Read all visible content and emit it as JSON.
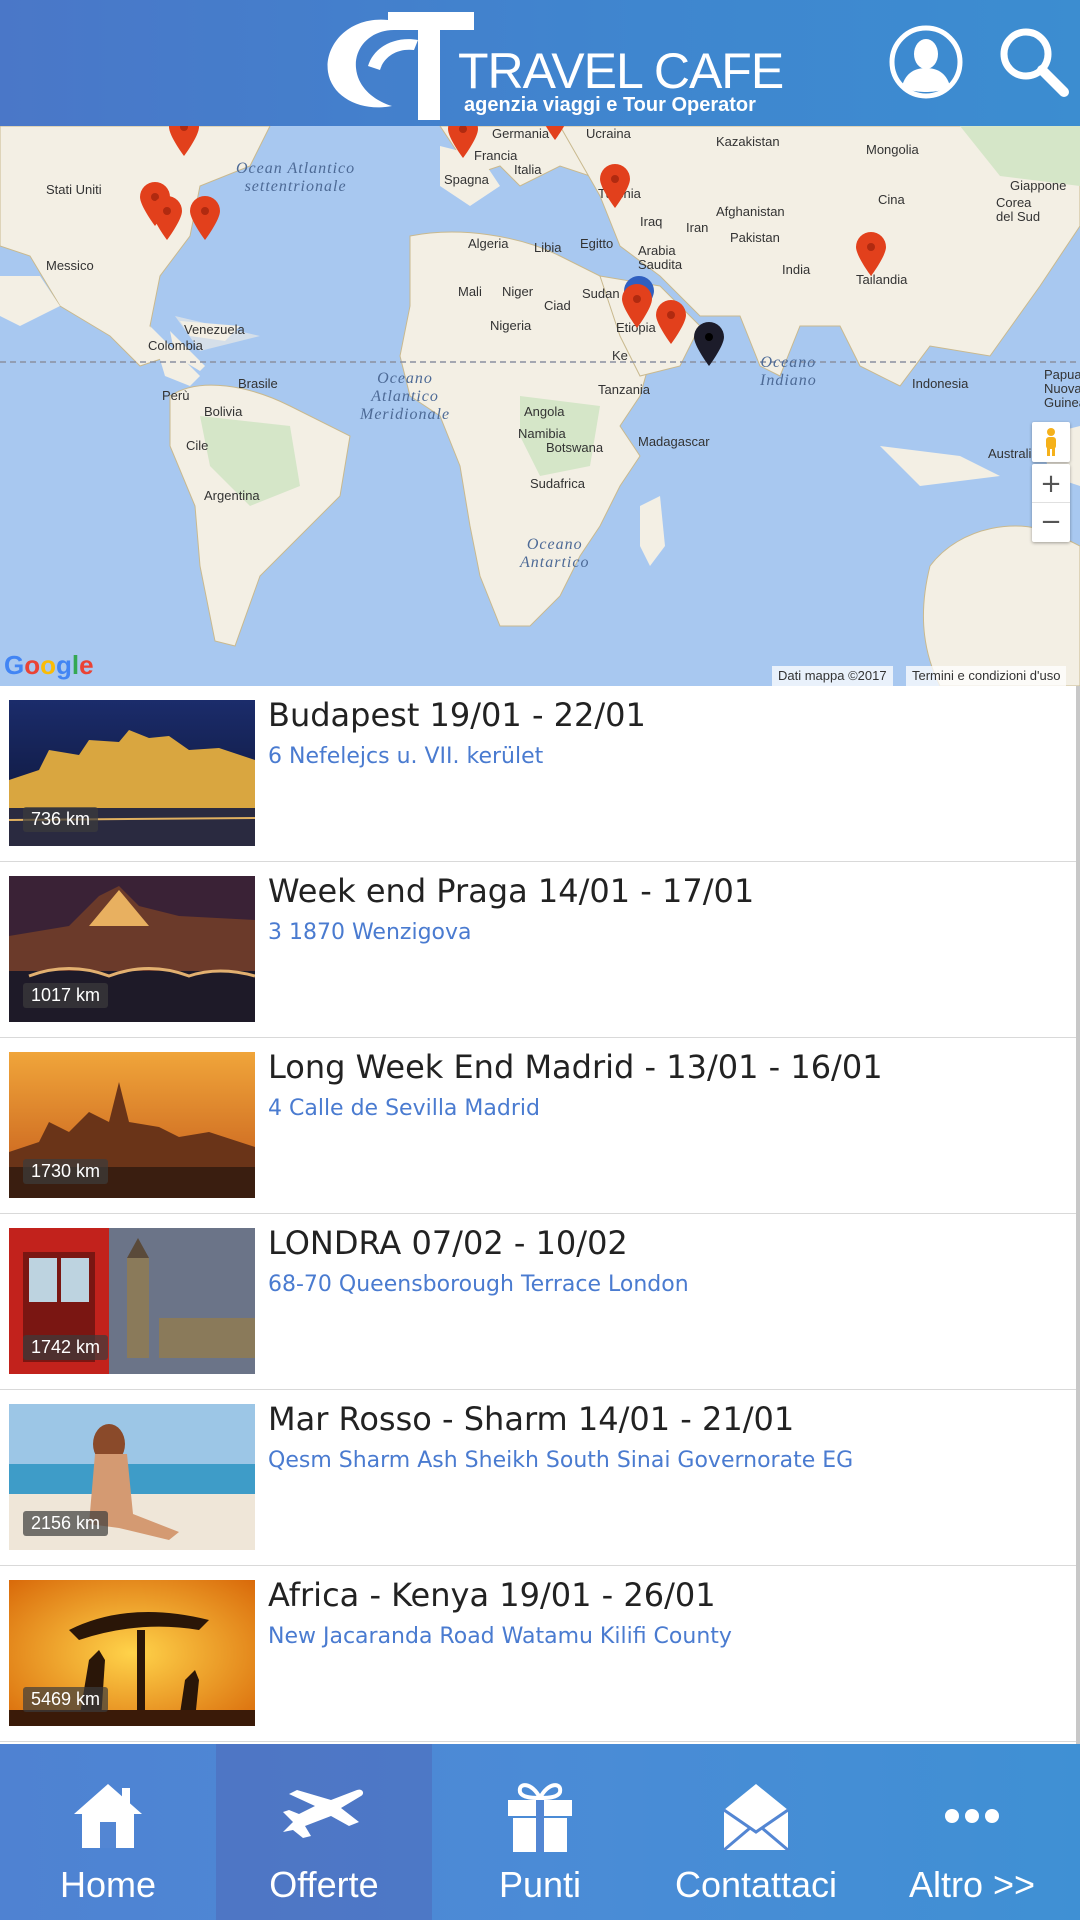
{
  "header": {
    "logo_text": "TRAVEL CAFE",
    "logo_subtitle": "agenzia viaggi e Tour Operator",
    "logo_mark": "CT"
  },
  "map": {
    "countries": {
      "stati_uniti": "Stati Uniti",
      "messico": "Messico",
      "venezuela": "Venezuela",
      "colombia": "Colombia",
      "peru": "Perù",
      "brasile": "Brasile",
      "bolivia": "Bolivia",
      "cile": "Cile",
      "argentina": "Argentina",
      "germania": "Germania",
      "ucraina": "Ucraina",
      "kazakistan": "Kazakistan",
      "mongolia": "Mongolia",
      "francia": "Francia",
      "italia": "Italia",
      "spagna": "Spagna",
      "turchia": "Turchia",
      "iraq": "Iraq",
      "iran": "Iran",
      "afghanistan": "Afghanistan",
      "pakistan": "Pakistan",
      "cina": "Cina",
      "giappone": "Giappone",
      "corea": "Corea\ndel Sud",
      "algeria": "Algeria",
      "libia": "Libia",
      "egitto": "Egitto",
      "arabia": "Arabia\nSaudita",
      "india": "India",
      "tailandia": "Tailandia",
      "mali": "Mali",
      "niger": "Niger",
      "ciad": "Ciad",
      "sudan": "Sudan",
      "nigeria": "Nigeria",
      "etiopia": "Etiopia",
      "kenya": "Ke",
      "tanzania": "Tanzania",
      "angola": "Angola",
      "namibia": "Namibia",
      "botswana": "Botswana",
      "madagascar": "Madagascar",
      "sudafrica": "Sudafrica",
      "indonesia": "Indonesia",
      "papua": "Papua\nNuova\nGuinea",
      "australia": "Australia"
    },
    "oceans": {
      "atl_n": "Ocean Atlantico\nsettentrionale",
      "atl_s": "Oceano\nAtlantico\nMeridionale",
      "indiano": "Oceano\nIndiano",
      "antartico": "Oceano\nAntartico"
    },
    "google": "Google",
    "attribution_data": "Dati mappa ©2017",
    "attribution_terms": "Termini e condizioni d'uso",
    "zoom_in": "+",
    "zoom_out": "−",
    "colors": {
      "water": "#a8c8f0",
      "land": "#f3efe4",
      "marker": "#e2401c",
      "marker_user": "#1c1c2a"
    }
  },
  "offers": [
    {
      "title": "Budapest 19/01 - 22/01",
      "address": "6 Nefelejcs u. VII. kerület",
      "distance": "736 km"
    },
    {
      "title": "Week end Praga 14/01 - 17/01",
      "address": "3 1870 Wenzigova",
      "distance": "1017 km"
    },
    {
      "title": "Long Week End Madrid - 13/01 - 16/01",
      "address": "4 Calle de Sevilla Madrid",
      "distance": "1730 km"
    },
    {
      "title": "LONDRA 07/02 - 10/02",
      "address": "68-70 Queensborough Terrace London",
      "distance": "1742 km"
    },
    {
      "title": "Mar Rosso - Sharm 14/01 - 21/01",
      "address": "Qesm Sharm Ash Sheikh South Sinai Governorate EG",
      "distance": "2156 km"
    },
    {
      "title": "Africa - Kenya 19/01 - 26/01",
      "address": "New Jacaranda Road Watamu Kilifi County",
      "distance": "5469 km"
    }
  ],
  "nav": {
    "home": "Home",
    "offerte": "Offerte",
    "punti": "Punti",
    "contattaci": "Contattaci",
    "altro": "Altro >>"
  }
}
